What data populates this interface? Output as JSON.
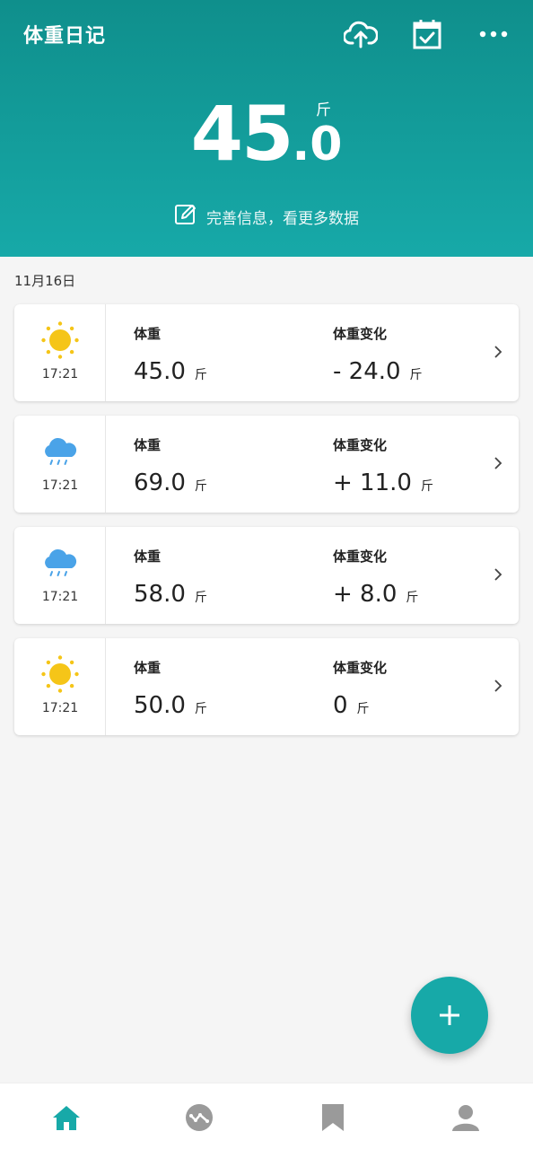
{
  "header": {
    "title": "体重日记",
    "icons": [
      "cloud-upload-icon",
      "calendar-check-icon",
      "more-icon"
    ],
    "current_weight_int": "45",
    "current_weight_dec": ".0",
    "unit": "斤",
    "edit_prompt": "完善信息，看更多数据"
  },
  "date_label": "11月16日",
  "records": [
    {
      "weather": "sunny-icon",
      "time": "17:21",
      "weight_label": "体重",
      "weight": "45.0",
      "weight_unit": "斤",
      "change_label": "体重变化",
      "change": "- 24.0",
      "change_unit": "斤"
    },
    {
      "weather": "rain-icon",
      "time": "17:21",
      "weight_label": "体重",
      "weight": "69.0",
      "weight_unit": "斤",
      "change_label": "体重变化",
      "change": "+ 11.0",
      "change_unit": "斤"
    },
    {
      "weather": "rain-icon",
      "time": "17:21",
      "weight_label": "体重",
      "weight": "58.0",
      "weight_unit": "斤",
      "change_label": "体重变化",
      "change": "+ 8.0",
      "change_unit": "斤"
    },
    {
      "weather": "sunny-icon",
      "time": "17:21",
      "weight_label": "体重",
      "weight": "50.0",
      "weight_unit": "斤",
      "change_label": "体重变化",
      "change": "0",
      "change_unit": "斤"
    }
  ],
  "fab": {
    "icon": "plus-icon"
  },
  "bottom_nav": [
    {
      "icon": "home-icon",
      "active": true
    },
    {
      "icon": "trend-icon",
      "active": false
    },
    {
      "icon": "bookmark-icon",
      "active": false
    },
    {
      "icon": "profile-icon",
      "active": false
    }
  ],
  "colors": {
    "accent": "#17a9a8",
    "header_top": "#0f8f8c",
    "sun": "#f5c518",
    "rain_cloud": "#4aa3e8",
    "inactive_nav": "#9a9a9a"
  }
}
